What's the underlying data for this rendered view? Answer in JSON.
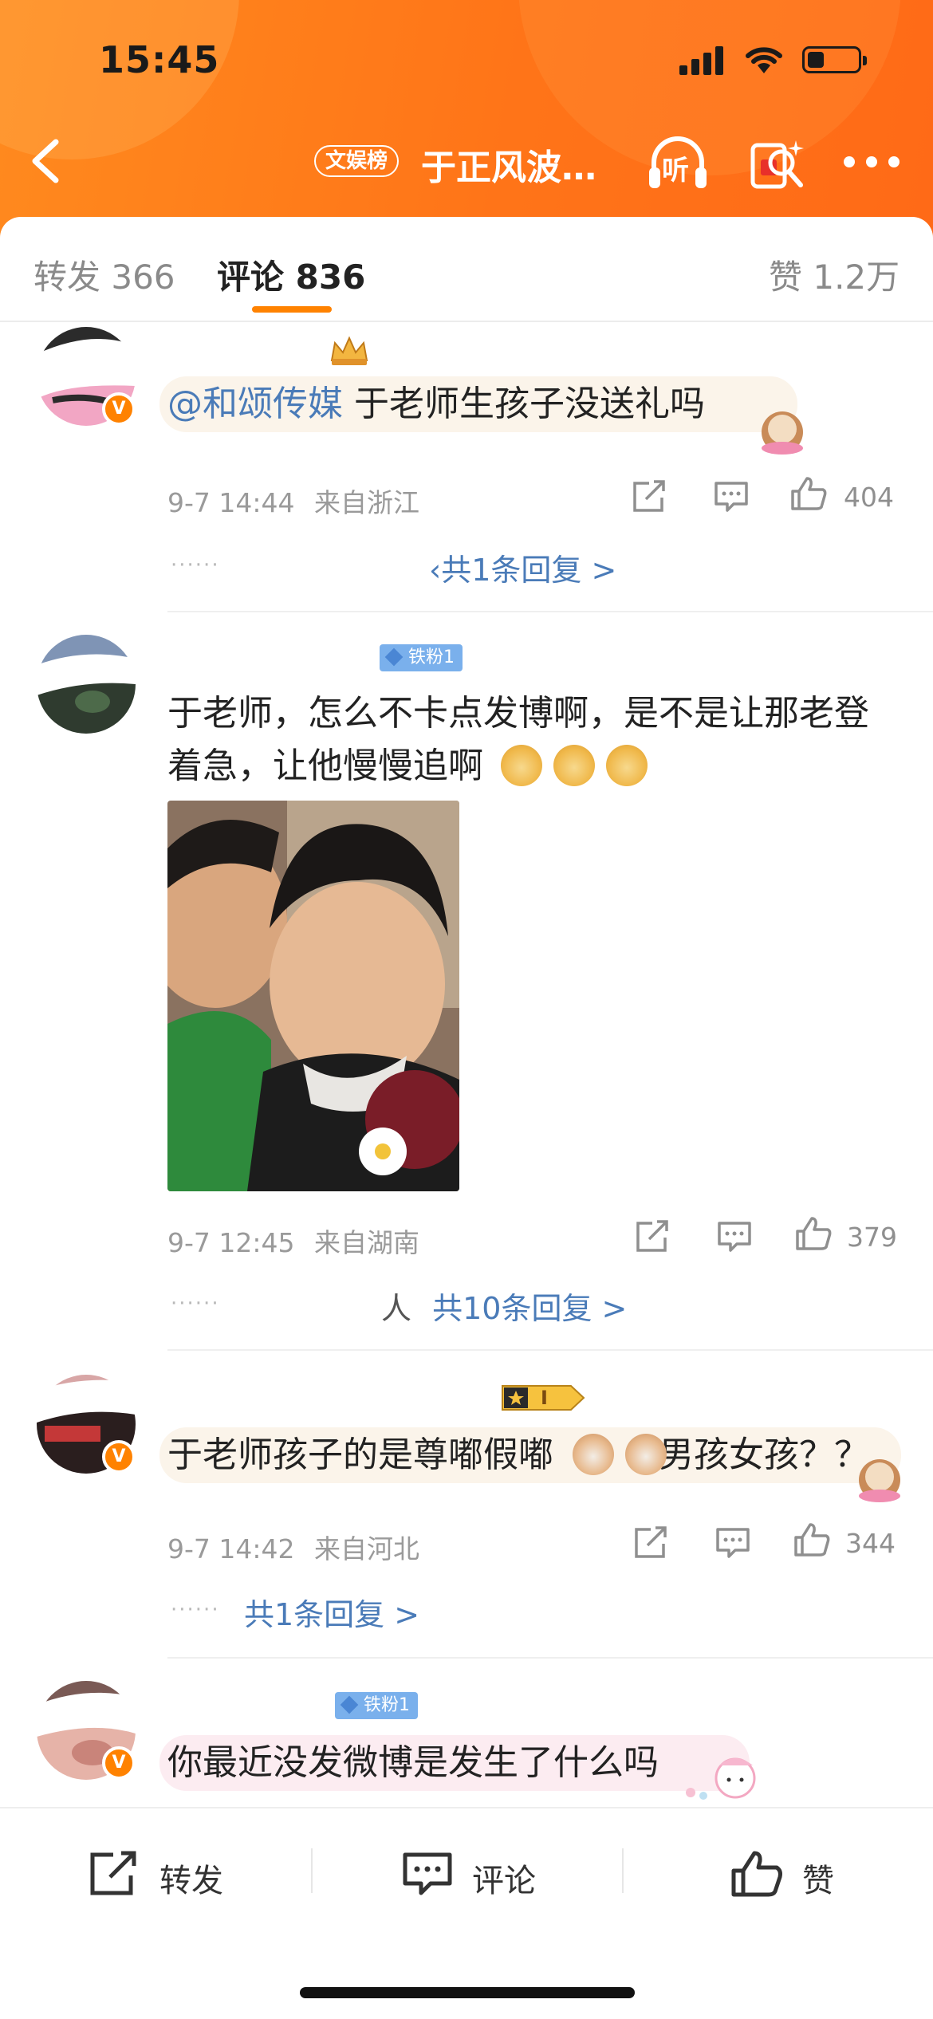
{
  "status_bar": {
    "time": "15:45"
  },
  "nav": {
    "badge": "文娱榜",
    "title": "于正风波…",
    "listen_label": "听"
  },
  "tabs": {
    "repost": "转发 366",
    "comments": "评论 836",
    "likes": "赞 1.2万"
  },
  "comments": [
    {
      "mention": "@和颂传媒",
      "text": "于老师生孩子没送礼吗",
      "time": "9-7 14:44",
      "location": "来自浙江",
      "likes": "404",
      "reply_link": "共1条回复 >",
      "reply_prefix": "‹"
    },
    {
      "fan_badge": "铁粉1",
      "text": "于老师，怎么不卡点发博啊，是不是让那老登着急，让他慢慢追啊",
      "time": "9-7 12:45",
      "location": "来自湖南",
      "likes": "379",
      "reply_prefix": "人",
      "reply_link": "共10条回复 >"
    },
    {
      "text": "于老师孩子的是尊嘟假嘟",
      "text_after": "男孩女孩？？",
      "rank_badge": "I",
      "time": "9-7 14:42",
      "location": "来自河北",
      "likes": "344",
      "reply_link": "共1条回复 >"
    },
    {
      "fan_badge": "铁粉1",
      "text": "你最近没发微博是发生了什么吗"
    }
  ],
  "bottom_bar": {
    "repost": "转发",
    "comment": "评论",
    "like": "赞"
  },
  "colors": {
    "brand_orange": "#ff8200",
    "link_blue": "#4a7bb8",
    "fan_badge_blue": "#7ab0ec"
  }
}
